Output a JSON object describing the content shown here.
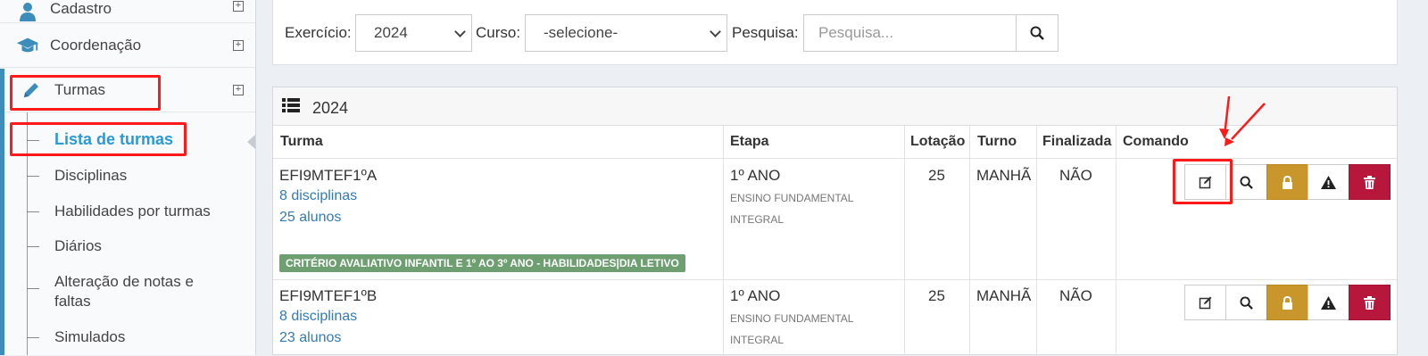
{
  "sidebar": {
    "top_item": "Cadastro",
    "coordenacao": "Coordenação",
    "turmas": "Turmas",
    "subitems": [
      "Lista de turmas",
      "Disciplinas",
      "Habilidades por turmas",
      "Diários",
      "Alteração de notas e",
      "faltas",
      "Simulados"
    ]
  },
  "filter": {
    "exercicio_label": "Exercício:",
    "exercicio_value": "2024",
    "curso_label": "Curso:",
    "curso_value": "-selecione-",
    "pesquisa_label": "Pesquisa:",
    "pesquisa_placeholder": "Pesquisa..."
  },
  "panel": {
    "title": "2024",
    "headers": [
      "Turma",
      "Etapa",
      "Lotação",
      "Turno",
      "Finalizada",
      "Comando"
    ],
    "rows": [
      {
        "turma": "EFI9MTEF1ºA",
        "disciplinas": "8 disciplinas",
        "alunos": "25 alunos",
        "etapa": "1º ANO",
        "etapa_sub1": "ENSINO FUNDAMENTAL",
        "etapa_sub2": "INTEGRAL",
        "lotacao": "25",
        "turno": "MANHÃ",
        "finalizada": "NÃO",
        "badge": "CRITÉRIO AVALIATIVO INFANTIL E 1º AO 3º ANO - HABILIDADES|DIA LETIVO"
      },
      {
        "turma": "EFI9MTEF1ºB",
        "disciplinas": "8 disciplinas",
        "alunos": "23 alunos",
        "etapa": "1º ANO",
        "etapa_sub1": "ENSINO FUNDAMENTAL",
        "etapa_sub2": "INTEGRAL",
        "lotacao": "25",
        "turno": "MANHÃ",
        "finalizada": "NÃO"
      }
    ]
  },
  "colors": {
    "accent": "#3c8dbc",
    "link": "#337ab7",
    "warning": "#c9962b",
    "danger": "#b7173b",
    "badge": "#6d9f71",
    "annotation": "#ff1a1a"
  },
  "icons": [
    "user-icon",
    "graduation-cap-icon",
    "pencil-icon",
    "plus-square-icon",
    "chevron-down-icon",
    "search-icon",
    "list-icon",
    "edit-icon",
    "lock-icon",
    "warning-icon",
    "trash-icon"
  ]
}
